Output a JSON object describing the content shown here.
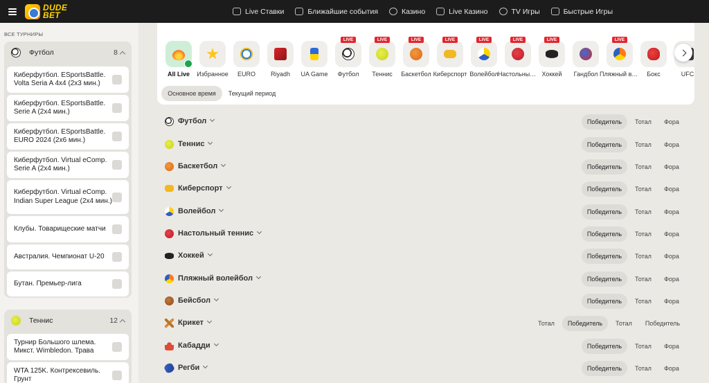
{
  "header": {
    "logo_line1": "DUDE",
    "logo_line2": "BET",
    "nav": [
      {
        "label": "Live Ставки",
        "icon": "live-bets-icon"
      },
      {
        "label": "Ближайшие события",
        "icon": "calendar-icon"
      },
      {
        "label": "Казино",
        "icon": "casino-chip-icon"
      },
      {
        "label": "Live Казино",
        "icon": "cards-icon"
      },
      {
        "label": "TV Игры",
        "icon": "tv-games-icon"
      },
      {
        "label": "Быстрые Игры",
        "icon": "rocket-icon"
      }
    ]
  },
  "sidebar": {
    "title": "ВСЕ ТУРНИРЫ",
    "groups": [
      {
        "name": "Футбол",
        "count": "8",
        "icon": "soccer-ball-icon",
        "leagues": [
          "Киберфутбол. ESportsBattle. Volta Seria A 4x4 (2x3 мин.)",
          "Киберфутбол. ESportsBattle. Serie A (2x4 мин.)",
          "Киберфутбол. ESportsBattle. EURO 2024 (2x6 мин.)",
          "Киберфутбол. Virtual eComp. Serie A (2x4 мин.)",
          "Киберфутбол. Virtual eComp. Indian Super League (2x4 мин.)",
          "Клубы. Товарищеские матчи",
          "Австралия. Чемпионат U-20",
          "Бутан. Премьер-лига"
        ]
      },
      {
        "name": "Теннис",
        "count": "12",
        "icon": "tennis-ball-icon",
        "leagues": [
          "Турнир Большого шлема. Микст. Wimbledon. Трава",
          "WTA 125K. Контрексевиль. Грунт"
        ]
      }
    ]
  },
  "sports_bar": {
    "chips": [
      {
        "label": "All Live",
        "icon": "fire-icon",
        "live": false,
        "active": true
      },
      {
        "label": "Избранное",
        "icon": "star-icon",
        "live": false,
        "active": false
      },
      {
        "label": "EURO",
        "icon": "euro-cup-icon",
        "live": false,
        "active": false
      },
      {
        "label": "Riyadh",
        "icon": "dota-icon",
        "live": false,
        "active": false
      },
      {
        "label": "UA Game",
        "icon": "ua-trident-icon",
        "live": false,
        "active": false
      },
      {
        "label": "Футбол",
        "icon": "soccer-ball-icon",
        "live": true,
        "active": false
      },
      {
        "label": "Теннис",
        "icon": "tennis-ball-icon",
        "live": true,
        "active": false
      },
      {
        "label": "Баскетбол",
        "icon": "basketball-icon",
        "live": true,
        "active": false
      },
      {
        "label": "Киберспорт",
        "icon": "gamepad-icon",
        "live": true,
        "active": false
      },
      {
        "label": "Волейбол",
        "icon": "volleyball-icon",
        "live": true,
        "active": false
      },
      {
        "label": "Настольный теннис",
        "icon": "table-tennis-icon",
        "live": true,
        "active": false
      },
      {
        "label": "Хоккей",
        "icon": "hockey-puck-icon",
        "live": true,
        "active": false
      },
      {
        "label": "Гандбол",
        "icon": "handball-icon",
        "live": false,
        "active": false
      },
      {
        "label": "Пляжный волейбол",
        "icon": "beach-volleyball-icon",
        "live": true,
        "active": false
      },
      {
        "label": "Бокс",
        "icon": "boxing-glove-icon",
        "live": false,
        "active": false
      },
      {
        "label": "UFC",
        "icon": "ufc-icon",
        "live": false,
        "active": false
      }
    ],
    "live_tag": "LIVE",
    "periods": [
      "Основное время",
      "Текущий период"
    ]
  },
  "rows": [
    {
      "name": "Футбол",
      "icon": "soccer-ball-icon",
      "markets": [
        "Победитель",
        "Тотал",
        "Фора"
      ]
    },
    {
      "name": "Теннис",
      "icon": "tennis-ball-icon",
      "markets": [
        "Победитель",
        "Тотал",
        "Фора"
      ]
    },
    {
      "name": "Баскетбол",
      "icon": "basketball-icon",
      "markets": [
        "Победитель",
        "Тотал",
        "Фора"
      ]
    },
    {
      "name": "Киберспорт",
      "icon": "gamepad-icon",
      "markets": [
        "Победитель",
        "Тотал",
        "Фора"
      ]
    },
    {
      "name": "Волейбол",
      "icon": "volleyball-icon",
      "markets": [
        "Победитель",
        "Тотал",
        "Фора"
      ]
    },
    {
      "name": "Настольный теннис",
      "icon": "table-tennis-icon",
      "markets": [
        "Победитель",
        "Тотал",
        "Фора"
      ]
    },
    {
      "name": "Хоккей",
      "icon": "hockey-puck-icon",
      "markets": [
        "Победитель",
        "Тотал",
        "Фора"
      ]
    },
    {
      "name": "Пляжный волейбол",
      "icon": "beach-volleyball-icon",
      "markets": [
        "Победитель",
        "Тотал",
        "Фора"
      ]
    },
    {
      "name": "Бейсбол",
      "icon": "baseball-glove-icon",
      "markets": [
        "Победитель",
        "Тотал",
        "Фора"
      ]
    },
    {
      "name": "Крикет",
      "icon": "cricket-bats-icon",
      "markets": [
        "Тотал",
        "Победитель",
        "Тотал",
        "Победитель"
      ]
    },
    {
      "name": "Кабадди",
      "icon": "kabaddi-icon",
      "markets": [
        "Победитель",
        "Тотал",
        "Фора"
      ]
    },
    {
      "name": "Регби",
      "icon": "rugby-ball-icon",
      "markets": [
        "Победитель",
        "Тотал",
        "Фора"
      ]
    }
  ],
  "colors": {
    "header_bg": "#1c1c1c",
    "logo_yellow": "#ffd400",
    "live_red": "#e3262e",
    "active_green": "#cfeed8",
    "check_green": "#1fa34a"
  }
}
